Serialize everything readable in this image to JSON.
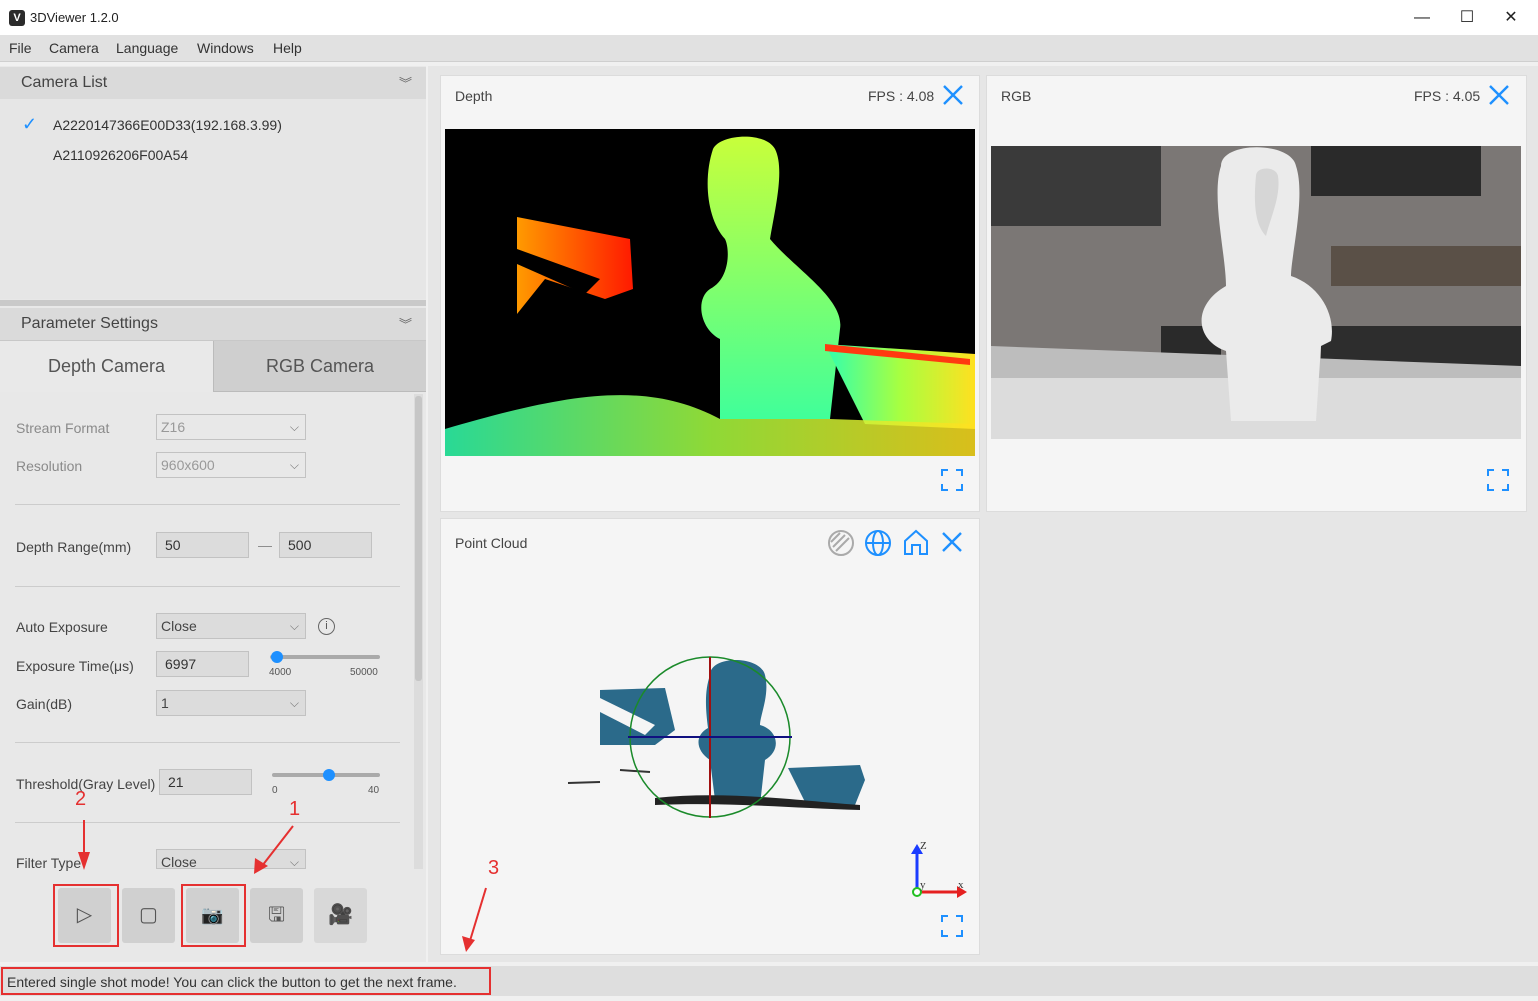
{
  "window": {
    "title": "3DViewer 1.2.0",
    "icon_letter": "V",
    "controls": {
      "minimize": "—",
      "maximize": "☐",
      "close": "✕"
    }
  },
  "menu": [
    "File",
    "Camera",
    "Language",
    "Windows",
    "Help"
  ],
  "camera_list": {
    "title": "Camera List",
    "items": [
      "A2220147366E00D33(192.168.3.99)",
      "A2110926206F00A54"
    ]
  },
  "parameters": {
    "title": "Parameter Settings",
    "tabs": [
      "Depth Camera",
      "RGB Camera"
    ],
    "stream_format": {
      "label": "Stream Format",
      "value": "Z16"
    },
    "resolution": {
      "label": "Resolution",
      "value": "960x600"
    },
    "depth_range": {
      "label": "Depth Range(mm)",
      "min": "50",
      "dash": "—",
      "max": "500"
    },
    "auto_exposure": {
      "label": "Auto Exposure",
      "value": "Close",
      "info": "i"
    },
    "exposure_time": {
      "label": "Exposure Time(μs)",
      "value": "6997",
      "min": "4000",
      "max": "50000",
      "level": 0.065
    },
    "gain": {
      "label": "Gain(dB)",
      "value": "1"
    },
    "threshold": {
      "label": "Threshold(Gray Level)",
      "value": "21",
      "min": "0",
      "max": "40",
      "level": 0.525
    },
    "filter_type": {
      "label": "Filter Type",
      "value": "Close"
    }
  },
  "toolbar": {
    "play_icon": "▷",
    "stop_icon": "▢",
    "capture_icon": "📷",
    "save_icon": "🖫",
    "record_icon": "🎥"
  },
  "annotations": {
    "one": "1",
    "two": "2",
    "three": "3"
  },
  "views": {
    "depth": {
      "title": "Depth",
      "fps": "FPS : 4.08"
    },
    "rgb": {
      "title": "RGB",
      "fps": "FPS : 4.05"
    },
    "pointcloud": {
      "title": "Point Cloud",
      "axis_z": "Z",
      "axis_y": "y",
      "axis_x": "x"
    }
  },
  "status": "Entered single shot mode! You can click the button to get the next frame.",
  "colors": {
    "accent": "#1e90ff",
    "annotation": "#e53030"
  }
}
